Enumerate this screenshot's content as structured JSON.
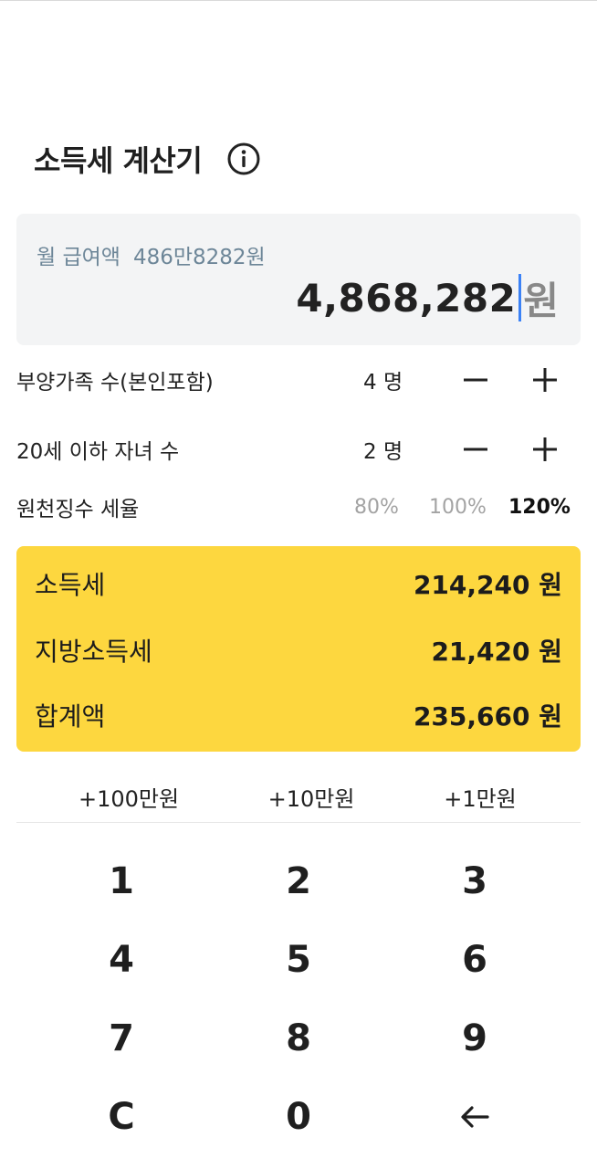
{
  "header": {
    "title": "소득세 계산기",
    "info_icon": "info-icon"
  },
  "salary": {
    "label": "월 급여액",
    "korean_amount": "486만8282원",
    "amount": "4,868,282",
    "unit": "원"
  },
  "dependents": {
    "label": "부양가족 수(본인포함)",
    "count": "4 명"
  },
  "children": {
    "label": "20세 이하 자녀 수",
    "count": "2 명"
  },
  "withholding": {
    "label": "원천징수 세율",
    "options": [
      "80%",
      "100%",
      "120%"
    ],
    "selected": "120%"
  },
  "results": [
    {
      "label": "소득세",
      "value": "214,240 원"
    },
    {
      "label": "지방소득세",
      "value": "21,420 원"
    },
    {
      "label": "합계액",
      "value": "235,660 원"
    }
  ],
  "quick_add": [
    "+100만원",
    "+10만원",
    "+1만원"
  ],
  "keypad": [
    "1",
    "2",
    "3",
    "4",
    "5",
    "6",
    "7",
    "8",
    "9",
    "C",
    "0"
  ],
  "colors": {
    "accent_yellow": "#fdd73f",
    "input_bg": "#f3f4f5",
    "label_blue_gray": "#6d8698",
    "caret_blue": "#3b82f6",
    "inactive_gray": "#a3a3a3"
  }
}
